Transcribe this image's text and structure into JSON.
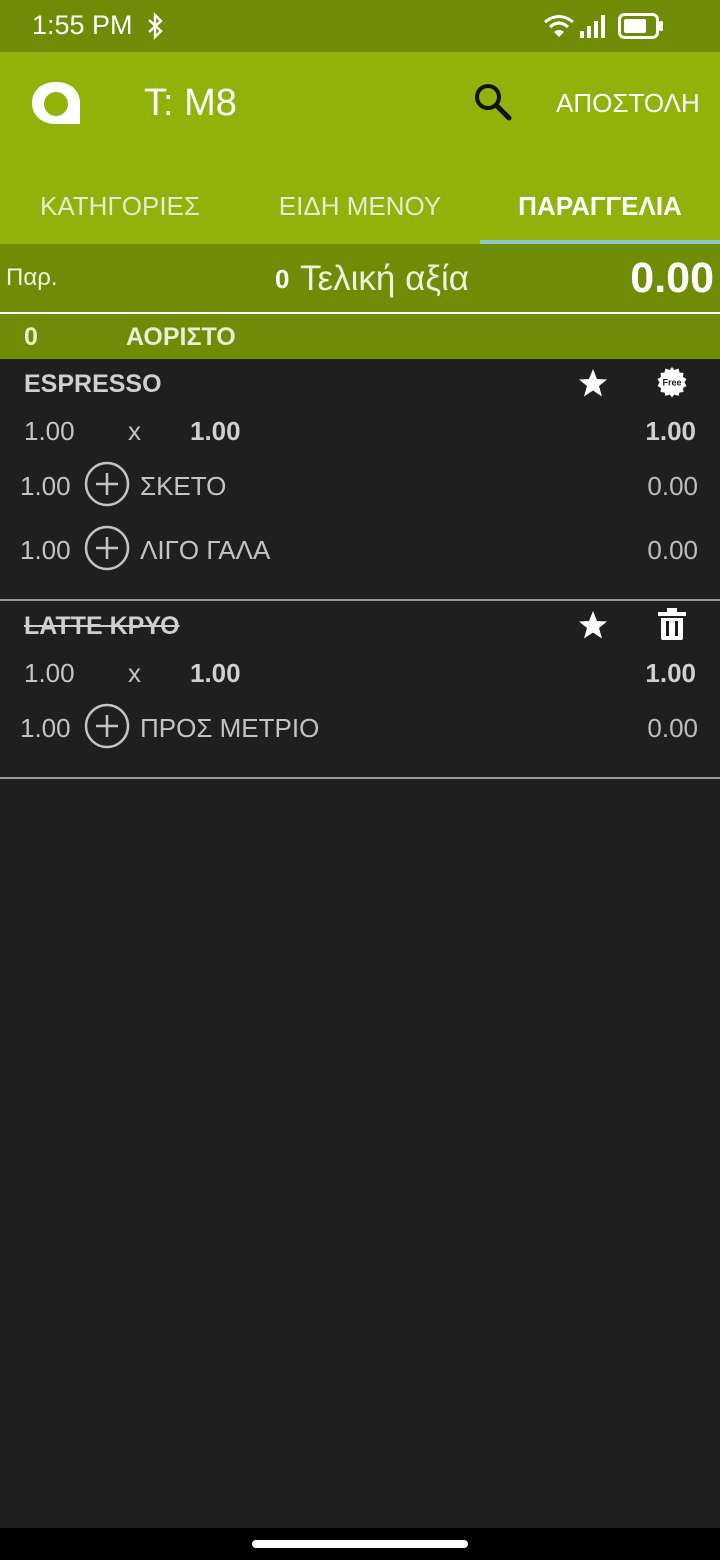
{
  "status": {
    "time": "1:55 PM"
  },
  "app": {
    "title": "T: M8",
    "send_label": "ΑΠΟΣΤΟΛΗ"
  },
  "tabs": [
    {
      "label": "ΚΑΤΗΓΟΡΙΕΣ",
      "active": false
    },
    {
      "label": "ΕΙΔΗ ΜΕΝΟΥ",
      "active": false
    },
    {
      "label": "ΠΑΡΑΓΓΕΛΙΑ",
      "active": true
    }
  ],
  "summary": {
    "label": "Παρ.",
    "count": "0",
    "total_label": "Τελική αξία",
    "total": "0.00"
  },
  "group": {
    "count": "0",
    "name": "ΑΟΡΙΣΤΟ"
  },
  "items": [
    {
      "name": "ESPRESSO",
      "struck": false,
      "icons": [
        "star-icon",
        "free-icon"
      ],
      "qty": "1.00",
      "times": "x",
      "price": "1.00",
      "total": "1.00",
      "modifiers": [
        {
          "qty": "1.00",
          "name": "ΣΚΕΤΟ",
          "price": "0.00"
        },
        {
          "qty": "1.00",
          "name": "ΛΙΓΟ ΓΑΛΑ",
          "price": "0.00"
        }
      ]
    },
    {
      "name": "LATTE ΚΡΥΟ",
      "struck": true,
      "icons": [
        "star-icon",
        "trash-icon"
      ],
      "qty": "1.00",
      "times": "x",
      "price": "1.00",
      "total": "1.00",
      "modifiers": [
        {
          "qty": "1.00",
          "name": "ΠΡΟΣ ΜΕΤΡΙΟ",
          "price": "0.00"
        }
      ]
    }
  ],
  "free_badge_text": "Free",
  "colors": {
    "status_bar": "#6e8c06",
    "app_bar": "#92b10b",
    "background": "#1f1f1f",
    "tab_indicator": "#8fc7c9"
  }
}
